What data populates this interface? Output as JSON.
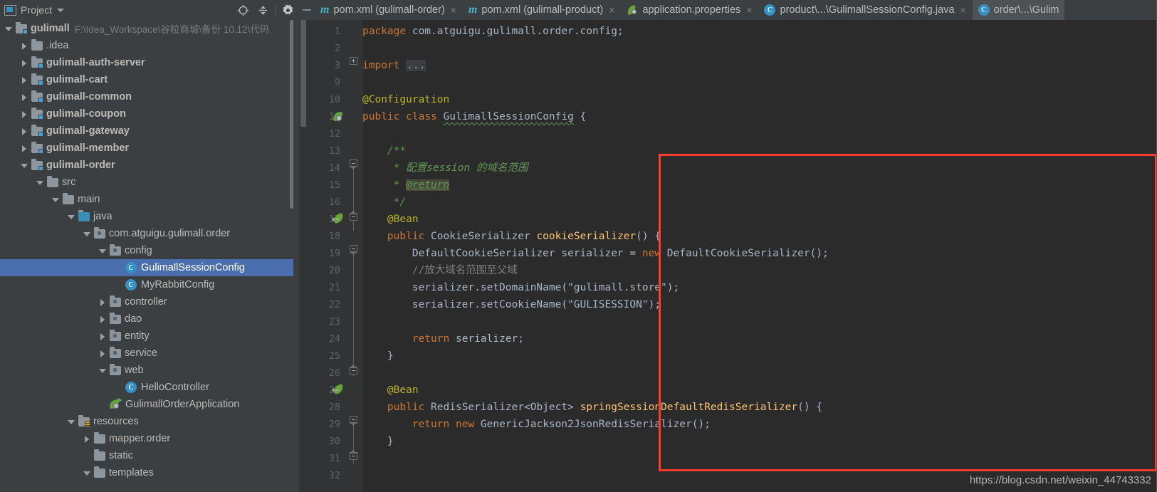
{
  "window": {
    "tool_window_title": "Project",
    "watermark": "https://blog.csdn.net/weixin_44743332"
  },
  "toolbar": {
    "locate_icon": "crosshair-locate-icon",
    "collapse_all_icon": "collapse-all-icon",
    "settings_icon": "gear-icon",
    "hide_icon": "minimize-icon"
  },
  "tabs": [
    {
      "label": "pom.xml (gulimall-order)",
      "icon": "maven-icon",
      "active": false,
      "close": "×"
    },
    {
      "label": "pom.xml (gulimall-product)",
      "icon": "maven-icon",
      "active": false,
      "close": "×"
    },
    {
      "label": "application.properties",
      "icon": "spring-icon",
      "active": false,
      "close": "×"
    },
    {
      "label": "product\\...\\GulimallSessionConfig.java",
      "icon": "class-icon",
      "active": false,
      "close": "×"
    },
    {
      "label": "order\\...\\Gulim",
      "icon": "class-icon",
      "active": true,
      "close": ""
    }
  ],
  "tree": [
    {
      "label": "gulimall",
      "path": "F:\\Idea_Workspace\\谷粒商城\\备份 10.12\\代码",
      "indent": 0,
      "arrow": "down",
      "icon": "module-folder-icon",
      "bold": true,
      "selected": false
    },
    {
      "label": ".idea",
      "indent": 1,
      "arrow": "right",
      "icon": "folder-icon",
      "selected": false
    },
    {
      "label": "gulimall-auth-server",
      "indent": 1,
      "arrow": "right",
      "icon": "module-folder-icon",
      "bold": true,
      "selected": false
    },
    {
      "label": "gulimall-cart",
      "indent": 1,
      "arrow": "right",
      "icon": "module-folder-icon",
      "bold": true,
      "selected": false
    },
    {
      "label": "gulimall-common",
      "indent": 1,
      "arrow": "right",
      "icon": "module-folder-icon",
      "bold": true,
      "selected": false
    },
    {
      "label": "gulimall-coupon",
      "indent": 1,
      "arrow": "right",
      "icon": "module-folder-icon",
      "bold": true,
      "selected": false
    },
    {
      "label": "gulimall-gateway",
      "indent": 1,
      "arrow": "right",
      "icon": "module-folder-icon",
      "bold": true,
      "selected": false
    },
    {
      "label": "gulimall-member",
      "indent": 1,
      "arrow": "right",
      "icon": "module-folder-icon",
      "bold": true,
      "selected": false
    },
    {
      "label": "gulimall-order",
      "indent": 1,
      "arrow": "down",
      "icon": "module-folder-icon",
      "bold": true,
      "selected": false
    },
    {
      "label": "src",
      "indent": 2,
      "arrow": "down",
      "icon": "folder-icon",
      "selected": false
    },
    {
      "label": "main",
      "indent": 3,
      "arrow": "down",
      "icon": "folder-icon",
      "selected": false
    },
    {
      "label": "java",
      "indent": 4,
      "arrow": "down",
      "icon": "source-folder-icon",
      "selected": false
    },
    {
      "label": "com.atguigu.gulimall.order",
      "indent": 5,
      "arrow": "down",
      "icon": "package-icon",
      "selected": false
    },
    {
      "label": "config",
      "indent": 6,
      "arrow": "down",
      "icon": "package-icon",
      "selected": false
    },
    {
      "label": "GulimallSessionConfig",
      "indent": 7,
      "arrow": "none",
      "icon": "class-icon",
      "selected": true
    },
    {
      "label": "MyRabbitConfig",
      "indent": 7,
      "arrow": "none",
      "icon": "class-icon",
      "selected": false
    },
    {
      "label": "controller",
      "indent": 6,
      "arrow": "right",
      "icon": "package-icon",
      "selected": false
    },
    {
      "label": "dao",
      "indent": 6,
      "arrow": "right",
      "icon": "package-icon",
      "selected": false
    },
    {
      "label": "entity",
      "indent": 6,
      "arrow": "right",
      "icon": "package-icon",
      "selected": false
    },
    {
      "label": "service",
      "indent": 6,
      "arrow": "right",
      "icon": "package-icon",
      "selected": false
    },
    {
      "label": "web",
      "indent": 6,
      "arrow": "down",
      "icon": "package-icon",
      "selected": false
    },
    {
      "label": "HelloController",
      "indent": 7,
      "arrow": "none",
      "icon": "class-icon",
      "selected": false
    },
    {
      "label": "GulimallOrderApplication",
      "indent": 6,
      "arrow": "none",
      "icon": "spring-run-icon",
      "selected": false
    },
    {
      "label": "resources",
      "indent": 4,
      "arrow": "down",
      "icon": "resources-folder-icon",
      "selected": false
    },
    {
      "label": "mapper.order",
      "indent": 5,
      "arrow": "right",
      "icon": "folder-icon",
      "selected": false
    },
    {
      "label": "static",
      "indent": 5,
      "arrow": "none",
      "icon": "folder-icon",
      "selected": false
    },
    {
      "label": "templates",
      "indent": 5,
      "arrow": "down",
      "icon": "folder-icon",
      "selected": false
    }
  ],
  "editor": {
    "line_numbers": [
      1,
      2,
      3,
      9,
      10,
      11,
      12,
      13,
      14,
      15,
      16,
      17,
      18,
      19,
      20,
      21,
      22,
      23,
      24,
      25,
      26,
      27,
      28,
      29,
      30,
      31,
      32
    ],
    "lines": [
      {
        "n": 1,
        "text": "package com.atguigu.gulimall.order.config;"
      },
      {
        "n": 2,
        "text": ""
      },
      {
        "n": 3,
        "text": "import ..."
      },
      {
        "n": 9,
        "text": ""
      },
      {
        "n": 10,
        "text": "@Configuration"
      },
      {
        "n": 11,
        "text": "public class GulimallSessionConfig {"
      },
      {
        "n": 12,
        "text": ""
      },
      {
        "n": 13,
        "text": "    /**"
      },
      {
        "n": 14,
        "text": "     * 配置session 的域名范围"
      },
      {
        "n": 15,
        "text": "     * @return"
      },
      {
        "n": 16,
        "text": "     */"
      },
      {
        "n": 17,
        "text": "    @Bean"
      },
      {
        "n": 18,
        "text": "    public CookieSerializer cookieSerializer() {"
      },
      {
        "n": 19,
        "text": "        DefaultCookieSerializer serializer = new DefaultCookieSerializer();"
      },
      {
        "n": 20,
        "text": "        //放大域名范围至父域"
      },
      {
        "n": 21,
        "text": "        serializer.setDomainName(\"gulimall.store\");"
      },
      {
        "n": 22,
        "text": "        serializer.setCookieName(\"GULISESSION\");"
      },
      {
        "n": 23,
        "text": ""
      },
      {
        "n": 24,
        "text": "        return serializer;"
      },
      {
        "n": 25,
        "text": "    }"
      },
      {
        "n": 26,
        "text": ""
      },
      {
        "n": 27,
        "text": "    @Bean"
      },
      {
        "n": 28,
        "text": "    public RedisSerializer<Object> springSessionDefaultRedisSerializer() {"
      },
      {
        "n": 29,
        "text": "        return new GenericJackson2JsonRedisSerializer();"
      },
      {
        "n": 30,
        "text": "    }"
      },
      {
        "n": 31,
        "text": ""
      },
      {
        "n": 32,
        "text": ""
      }
    ],
    "gutter_icons": [
      {
        "line": 11,
        "icon": "spring-bean-icon"
      },
      {
        "line": 17,
        "icon": "spring-bean-arrow-icon"
      },
      {
        "line": 27,
        "icon": "spring-bean-arrow-icon"
      }
    ]
  },
  "colors": {
    "editor_bg": "#2b2b2b",
    "ide_bg": "#3c3f41",
    "selection": "#4b6eaf",
    "keyword": "#cc7832",
    "annotation": "#bbb529",
    "string": "#6a8759",
    "comment": "#808080",
    "javadoc": "#629755",
    "method": "#ffc66d",
    "highlight_box": "#ff3b30"
  }
}
